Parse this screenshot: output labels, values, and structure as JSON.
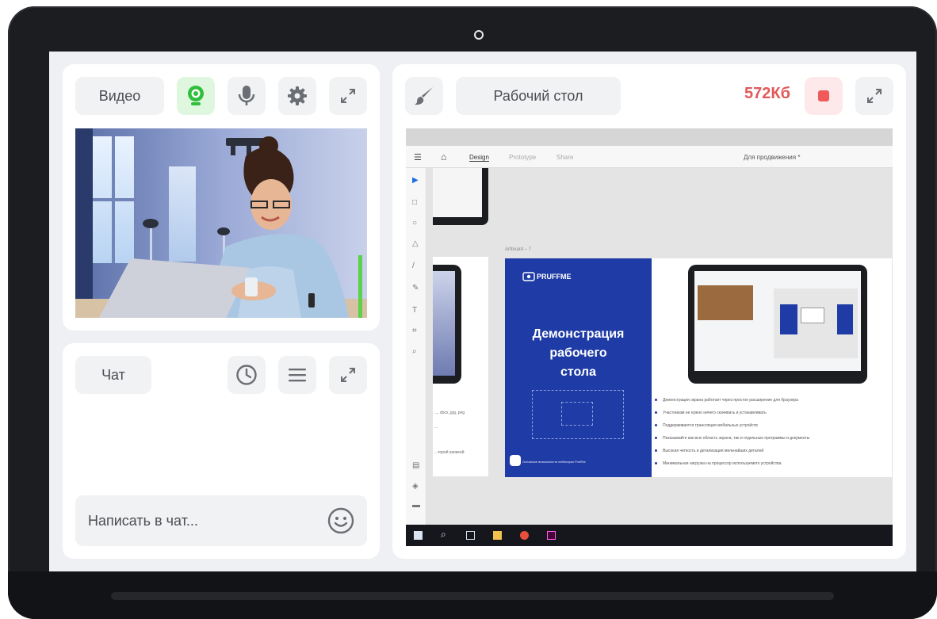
{
  "video_panel": {
    "label": "Видео",
    "icons": [
      "webcam-icon",
      "microphone-icon",
      "gear-icon",
      "expand-icon"
    ]
  },
  "chat_panel": {
    "label": "Чат",
    "input_placeholder": "Написать в чат...",
    "icons": [
      "history-icon",
      "menu-icon",
      "expand-icon",
      "emoji-icon"
    ]
  },
  "desktop_panel": {
    "label": "Рабочий стол",
    "size": "572Кб",
    "icons": [
      "brush-icon",
      "record-stop-icon",
      "expand-icon"
    ]
  },
  "shared_screen": {
    "tabs": [
      "Design",
      "Prototype",
      "Share"
    ],
    "doc_title": "Для продвижения *",
    "artboard_label": "Artboard – 7",
    "brand": "PRUFFME",
    "card_title_line1": "Демонстрация",
    "card_title_line2": "рабочего",
    "card_title_line3": "стола",
    "card_footer": "Основные возможности вебинарки PruffMe",
    "side_text": [
      "..., docx, jpg, png",
      "...",
      "...торой записей"
    ],
    "bullets": [
      "Демонстрация экрана работает через простое расширение для браузера",
      "Участникам не нужно ничего скачивать и устанавливать",
      "Поддерживается трансляция мобильных устройств",
      "Показывайте как всю область экрана, так и отдельные программы и документы",
      "Высокая четкость и детализация мельчайших деталей",
      "Минимальная нагрузка на процессор используемого устройства"
    ]
  },
  "colors": {
    "accent_green": "#2fbf3b",
    "record_red": "#f05a5a",
    "size_red": "#e05a5a",
    "card_blue": "#1f3ca6",
    "bezel": "#1c1d20"
  }
}
